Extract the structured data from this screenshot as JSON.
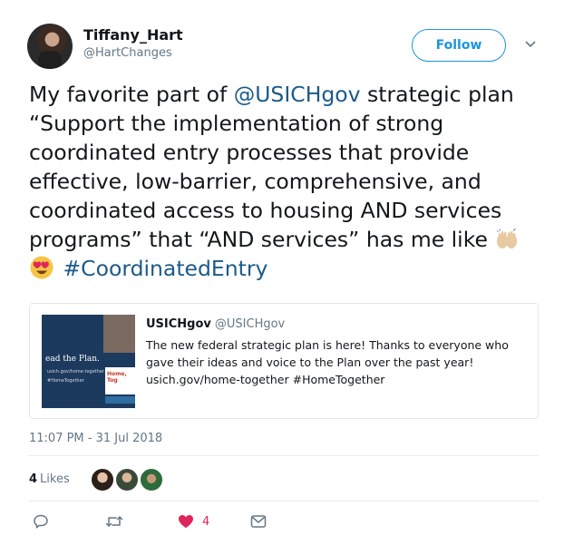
{
  "user": {
    "display_name": "Tiffany_Hart",
    "handle": "@HartChanges",
    "follow_label": "Follow"
  },
  "tweet": {
    "text_part1": "My favorite part of ",
    "mention": "@USICHgov",
    "text_part2": " strategic plan “Support the implementation of strong coordinated entry processes that provide effective, low-barrier, comprehensive, and coordinated access to housing AND services programs” that “AND services” has me like ",
    "emojis": [
      "raising-hands-icon",
      "heart-eyes-icon"
    ],
    "hashtag": "#CoordinatedEntry"
  },
  "quote": {
    "name": "USICHgov",
    "handle": "@USICHgov",
    "text_line1": "The new federal strategic plan is here! Thanks to everyone who",
    "text_line2": "gave their ideas and voice to the Plan over the past year!",
    "text_line3": "usich.gov/home-together #HomeTogether",
    "image": {
      "line1": "ead the Plan.",
      "line2": "usich.gov/home-together",
      "line3": "#HomeTogether",
      "cover_title": "Home, Tog"
    }
  },
  "timestamp": "11:07 PM - 31 Jul 2018",
  "likes": {
    "count": "4",
    "label": "Likes"
  },
  "actions": {
    "like_count": "4"
  },
  "colors": {
    "accent": "#1b95e0",
    "link": "#1b5a8a",
    "like": "#e0245e",
    "secondary": "#657786"
  }
}
